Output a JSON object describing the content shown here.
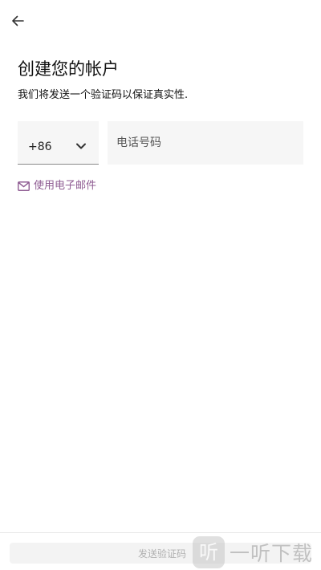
{
  "header": {
    "back_icon": "arrow-left-icon"
  },
  "main": {
    "title": "创建您的帐户",
    "subtitle": "我们将发送一个验证码以保证真实性.",
    "country_code": {
      "value": "+86",
      "icon": "chevron-down-icon"
    },
    "phone": {
      "placeholder": "电话号码",
      "value": ""
    },
    "email_link": {
      "label": "使用电子邮件",
      "icon": "mail-icon",
      "color": "#8e5b92"
    }
  },
  "footer": {
    "send_code_label": "发送验证码",
    "send_code_enabled": false
  },
  "watermark": {
    "logo_char": "听",
    "text": "一听下载"
  }
}
